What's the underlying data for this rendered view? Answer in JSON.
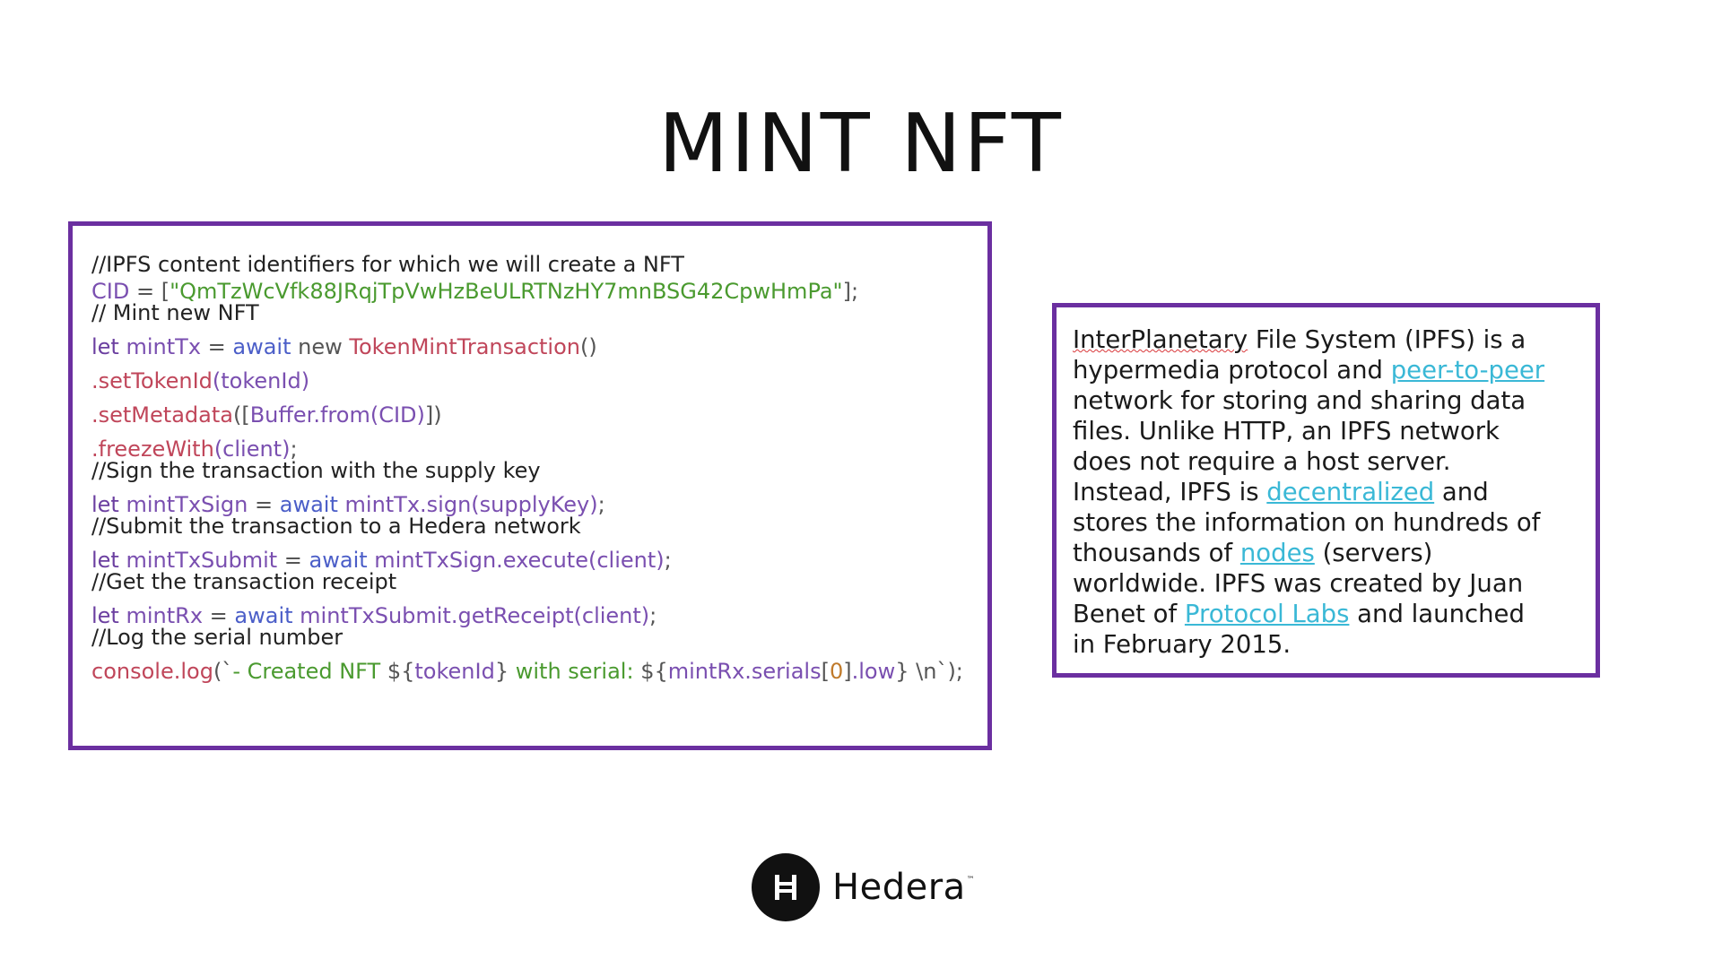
{
  "slide": {
    "title": "MINT NFT"
  },
  "code": {
    "comment_ipfs": "//IPFS content identifiers for which we will create a NFT",
    "cid_var": "CID",
    "cid_eq": " = [",
    "cid_value": "\"QmTzWcVfk88JRqjTpVwHzBeULRTNzHY7mnBSG42CpwHmPa\"",
    "cid_end": "];",
    "comment_mint": "// Mint new NFT",
    "let": "let",
    "await": "await",
    "new": "new",
    "mint_tx_var": "mintTx",
    "mint_tx_class": "TokenMintTransaction",
    "parens": "()",
    "set_token_id": ".setTokenId",
    "token_id_arg": "(tokenId)",
    "set_metadata": ".setMetadata",
    "metadata_arg_open": "([",
    "buffer_from": "Buffer.from",
    "metadata_arg_inner": "(CID)",
    "metadata_arg_close": "])",
    "freeze_with": ".freezeWith",
    "client_arg": "(client)",
    "semicolon": ";",
    "comment_sign": "//Sign the transaction with the supply key",
    "sign_var": "mintTxSign",
    "sign_call": "mintTx.sign",
    "sign_arg": "(supplyKey)",
    "comment_submit": "//Submit the transaction to a Hedera network",
    "submit_var": "mintTxSubmit",
    "submit_call": "mintTxSign.execute",
    "comment_receipt": "//Get the transaction receipt",
    "rx_var": "mintRx",
    "rx_call": "mintTxSubmit.getReceipt",
    "comment_log": "//Log the serial number",
    "console_log": "console.log",
    "log_open": "(`",
    "log_text1": "- Created NFT ",
    "log_interp1_open": "${",
    "log_token": "tokenId",
    "log_interp_close": "}",
    "log_text2": " with serial: ",
    "log_serials": "mintRx.serials",
    "log_bracket_open": "[",
    "log_zero": "0",
    "log_bracket_close": "]",
    "log_low": ".low",
    "log_end": " \\n`);"
  },
  "info": {
    "l1_a": "InterPlanetary",
    "l1_b": " File System (IPFS) is a",
    "l2_a": "hypermedia protocol and ",
    "l2_link": "peer-to-peer",
    "l3": "network for storing and sharing data",
    "l4": "files. Unlike HTTP, an IPFS network",
    "l5": "does not require a host server.",
    "l6_a": "Instead, IPFS is ",
    "l6_link": "decentralized",
    "l6_b": " and",
    "l7": "stores the information on hundreds of",
    "l8_a": "thousands of ",
    "l8_link": "nodes",
    "l8_b": " (servers)",
    "l9": "worldwide. IPFS was created by Juan",
    "l10_a": "Benet of ",
    "l10_link": "Protocol Labs",
    "l10_b": " and launched",
    "l11": "in February 2015."
  },
  "logo": {
    "name": "Hedera",
    "tm": "™",
    "icon": "hedera-h-icon"
  }
}
